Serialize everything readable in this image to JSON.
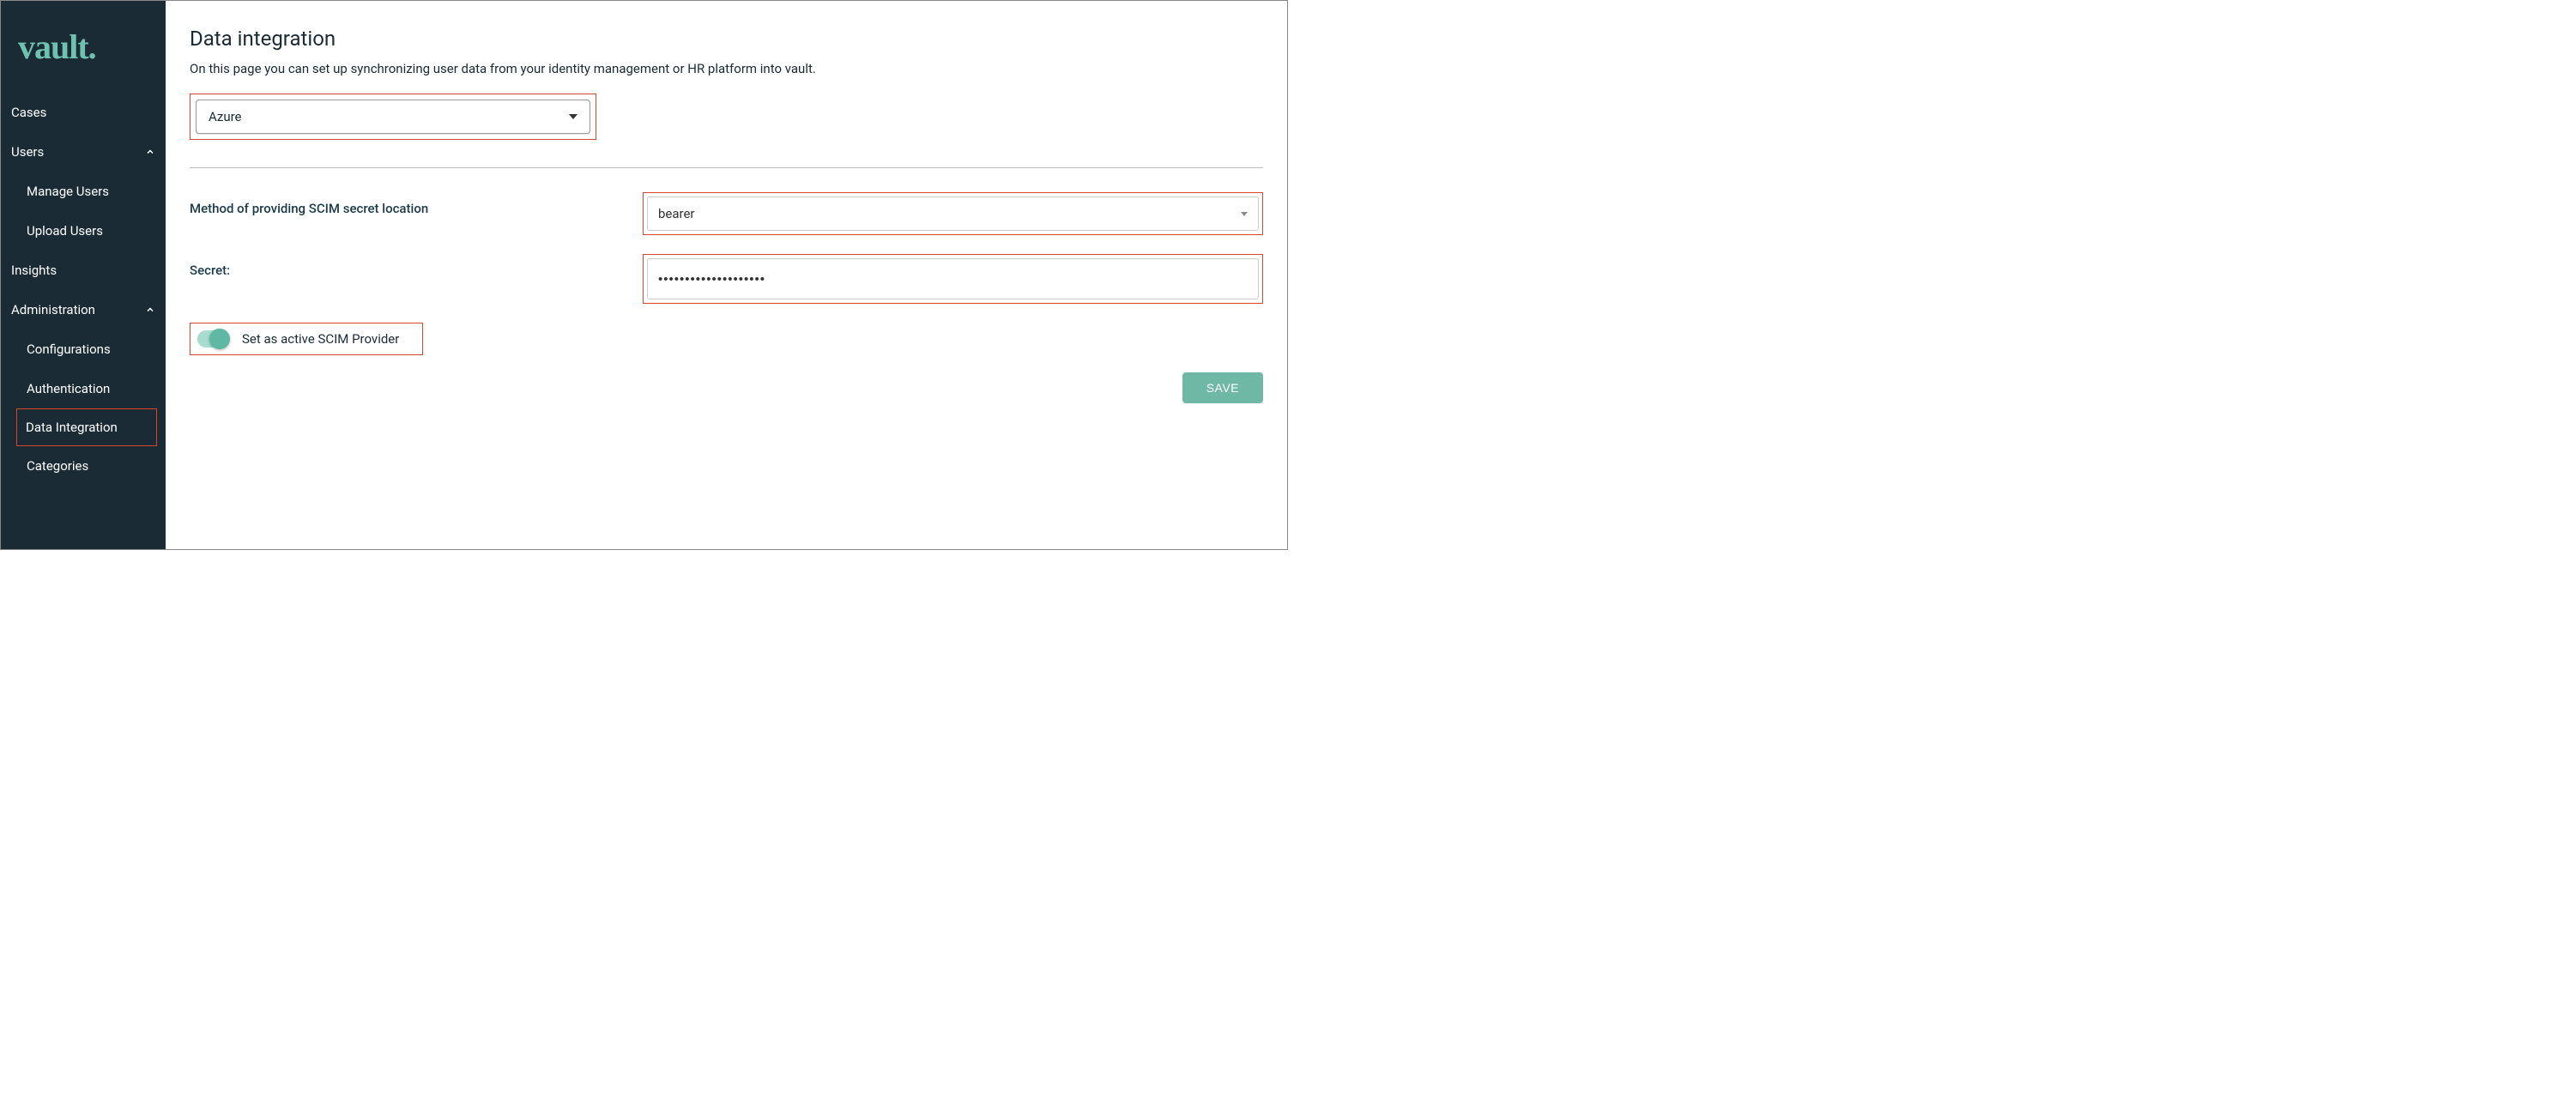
{
  "brand": "vault.",
  "sidebar": {
    "items": [
      {
        "label": "Cases"
      },
      {
        "label": "Users"
      },
      {
        "label": "Insights"
      },
      {
        "label": "Administration"
      }
    ],
    "users_sub": [
      {
        "label": "Manage Users"
      },
      {
        "label": "Upload Users"
      }
    ],
    "admin_sub": [
      {
        "label": "Configurations"
      },
      {
        "label": "Authentication"
      },
      {
        "label": "Data Integration"
      },
      {
        "label": "Categories"
      }
    ]
  },
  "page": {
    "title": "Data integration",
    "description": "On this page you can set up synchronizing user data from your identity management or HR platform into vault.",
    "provider_select": "Azure",
    "scim_method_label": "Method of providing SCIM secret location",
    "scim_method_value": "bearer",
    "secret_label": "Secret:",
    "secret_value": "••••••••••••••••••••",
    "toggle_label": "Set as active SCIM Provider",
    "save_label": "SAVE"
  }
}
